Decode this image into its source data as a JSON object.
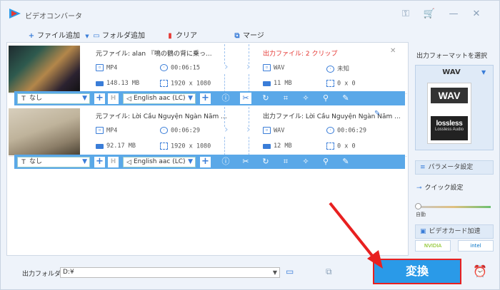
{
  "window": {
    "title": "ビデオコンバータ"
  },
  "toolbar": {
    "add_file": "ファイル追加",
    "add_folder": "フォルダ追加",
    "clear": "クリア",
    "merge": "マージ"
  },
  "items": [
    {
      "src_title": "元ファイル: alan 『鳴の鶴の背に乗っ...",
      "src_format": "MP4",
      "src_duration": "00:06:15",
      "src_size": "148.13 MB",
      "src_resolution": "1920 x 1080",
      "out_title": "出力ファイル: 2 クリップ",
      "out_format": "WAV",
      "out_duration": "未知",
      "out_size": "11 MB",
      "out_resolution": "0 x 0",
      "subtitle": "なし",
      "audio": "English aac (LC)"
    },
    {
      "src_title": "元ファイル: Lời Cầu Nguyện Ngàn Năm ...",
      "src_format": "MP4",
      "src_duration": "00:06:29",
      "src_size": "92.17 MB",
      "src_resolution": "1920 x 1080",
      "out_title": "出力ファイル: Lời Cầu Nguyện Ngàn Năm ...",
      "out_format": "WAV",
      "out_duration": "00:06:29",
      "out_size": "12 MB",
      "out_resolution": "0 x 0",
      "subtitle": "なし",
      "audio": "English aac (LC)"
    }
  ],
  "right_panel": {
    "format_label": "出力フォーマットを選択",
    "format_name": "WAV",
    "wav_icon_text": "WAV",
    "lossless_text": "lossless",
    "lossless_sub": "Lossless Audio",
    "param_settings": "パラメータ設定",
    "quick_settings": "クイック設定",
    "auto_label": "自動",
    "gpu_accel": "ビデオカード加速",
    "nvidia": "NVIDIA",
    "intel": "intel"
  },
  "bottom": {
    "output_folder_label": "出力フォルダ:",
    "output_folder_value": "D:¥",
    "convert": "変換"
  },
  "colors": {
    "accent": "#2a9ae8",
    "bar": "#5aa8e8",
    "highlight": "#e82020"
  }
}
